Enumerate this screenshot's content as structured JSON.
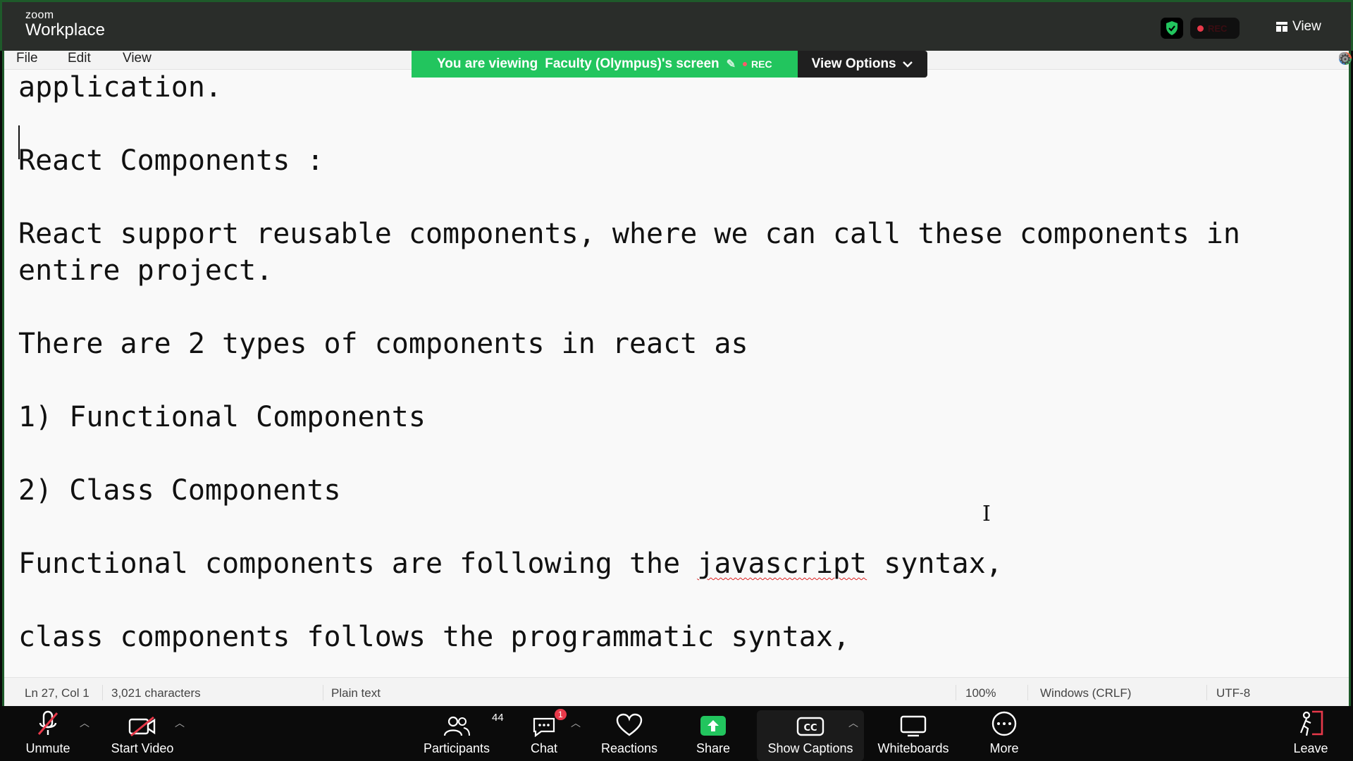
{
  "zoom": {
    "brand_small": "zoom",
    "brand_big": "Workplace",
    "rec_label": "REC",
    "view_label": "View"
  },
  "banner": {
    "viewing_prefix": "You are viewing",
    "viewing_name": "Faculty (Olympus)'s screen",
    "rec_label": "REC",
    "view_options_label": "View Options"
  },
  "notepad": {
    "menu": [
      "File",
      "Edit",
      "View"
    ],
    "lines": {
      "l1": "application.",
      "l2": "React Components :",
      "l3": "React support reusable components, where we can call these components in",
      "l4": "entire project.",
      "l5": "There are 2 types of components in react as",
      "l6": "1) Functional Components",
      "l7": "2) Class Components",
      "l8_before": "Functional components are following the ",
      "l8_misspelled": "javascript",
      "l8_after": " syntax,",
      "l9": "class components follows the programmatic syntax,"
    },
    "status": {
      "position": "Ln 27, Col 1",
      "characters": "3,021 characters",
      "type": "Plain text",
      "zoom": "100%",
      "line_ending": "Windows (CRLF)",
      "encoding": "UTF-8"
    }
  },
  "toolbar": {
    "unmute": "Unmute",
    "start_video": "Start Video",
    "participants": "Participants",
    "participants_count": "44",
    "chat": "Chat",
    "chat_badge": "1",
    "reactions": "Reactions",
    "share": "Share",
    "show_captions": "Show Captions",
    "whiteboards": "Whiteboards",
    "more": "More",
    "leave": "Leave"
  },
  "colors": {
    "banner_green": "#22c55e",
    "share_green": "#22c55e",
    "rec_red": "#e8394a",
    "leave_red": "#e8394a"
  }
}
